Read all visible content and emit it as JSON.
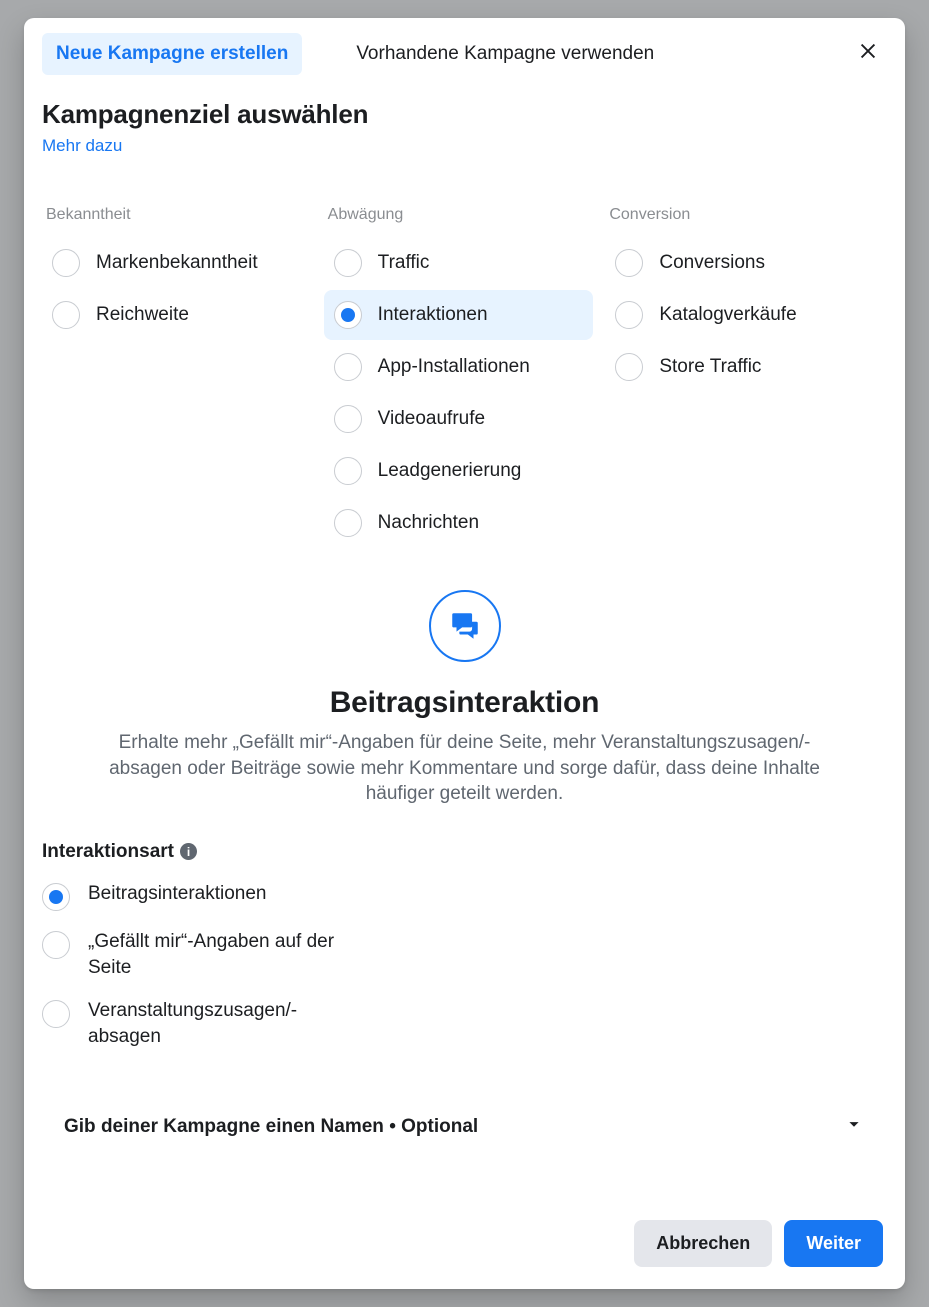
{
  "header": {
    "tab_create": "Neue Kampagne erstellen",
    "tab_existing": "Vorhandene Kampagne verwenden"
  },
  "section": {
    "title": "Kampagnenziel auswählen",
    "learn_more": "Mehr dazu"
  },
  "columns": {
    "awareness": {
      "label": "Bekanntheit",
      "items": [
        "Markenbekanntheit",
        "Reichweite"
      ]
    },
    "consideration": {
      "label": "Abwägung",
      "items": [
        "Traffic",
        "Interaktionen",
        "App-Installationen",
        "Videoaufrufe",
        "Leadgenerierung",
        "Nachrichten"
      ],
      "selected_index": 1
    },
    "conversion": {
      "label": "Conversion",
      "items": [
        "Conversions",
        "Katalogverkäufe",
        "Store Traffic"
      ]
    }
  },
  "explain": {
    "title": "Beitragsinteraktion",
    "text": "Erhalte mehr „Gefällt mir“-Angaben für deine Seite, mehr Veranstaltungszusagen/-absagen oder Beiträge sowie mehr Kommentare und sorge dafür, dass deine Inhalte häufiger geteilt werden."
  },
  "interaction_type": {
    "label": "Interaktionsart",
    "options": [
      "Beitragsinteraktionen",
      "„Gefällt mir“-Angaben auf der Seite",
      "Veranstaltungszusagen/-absagen"
    ],
    "selected_index": 0
  },
  "name_row": "Gib deiner Kampagne einen Namen • Optional",
  "footer": {
    "cancel": "Abbrechen",
    "continue": "Weiter"
  }
}
